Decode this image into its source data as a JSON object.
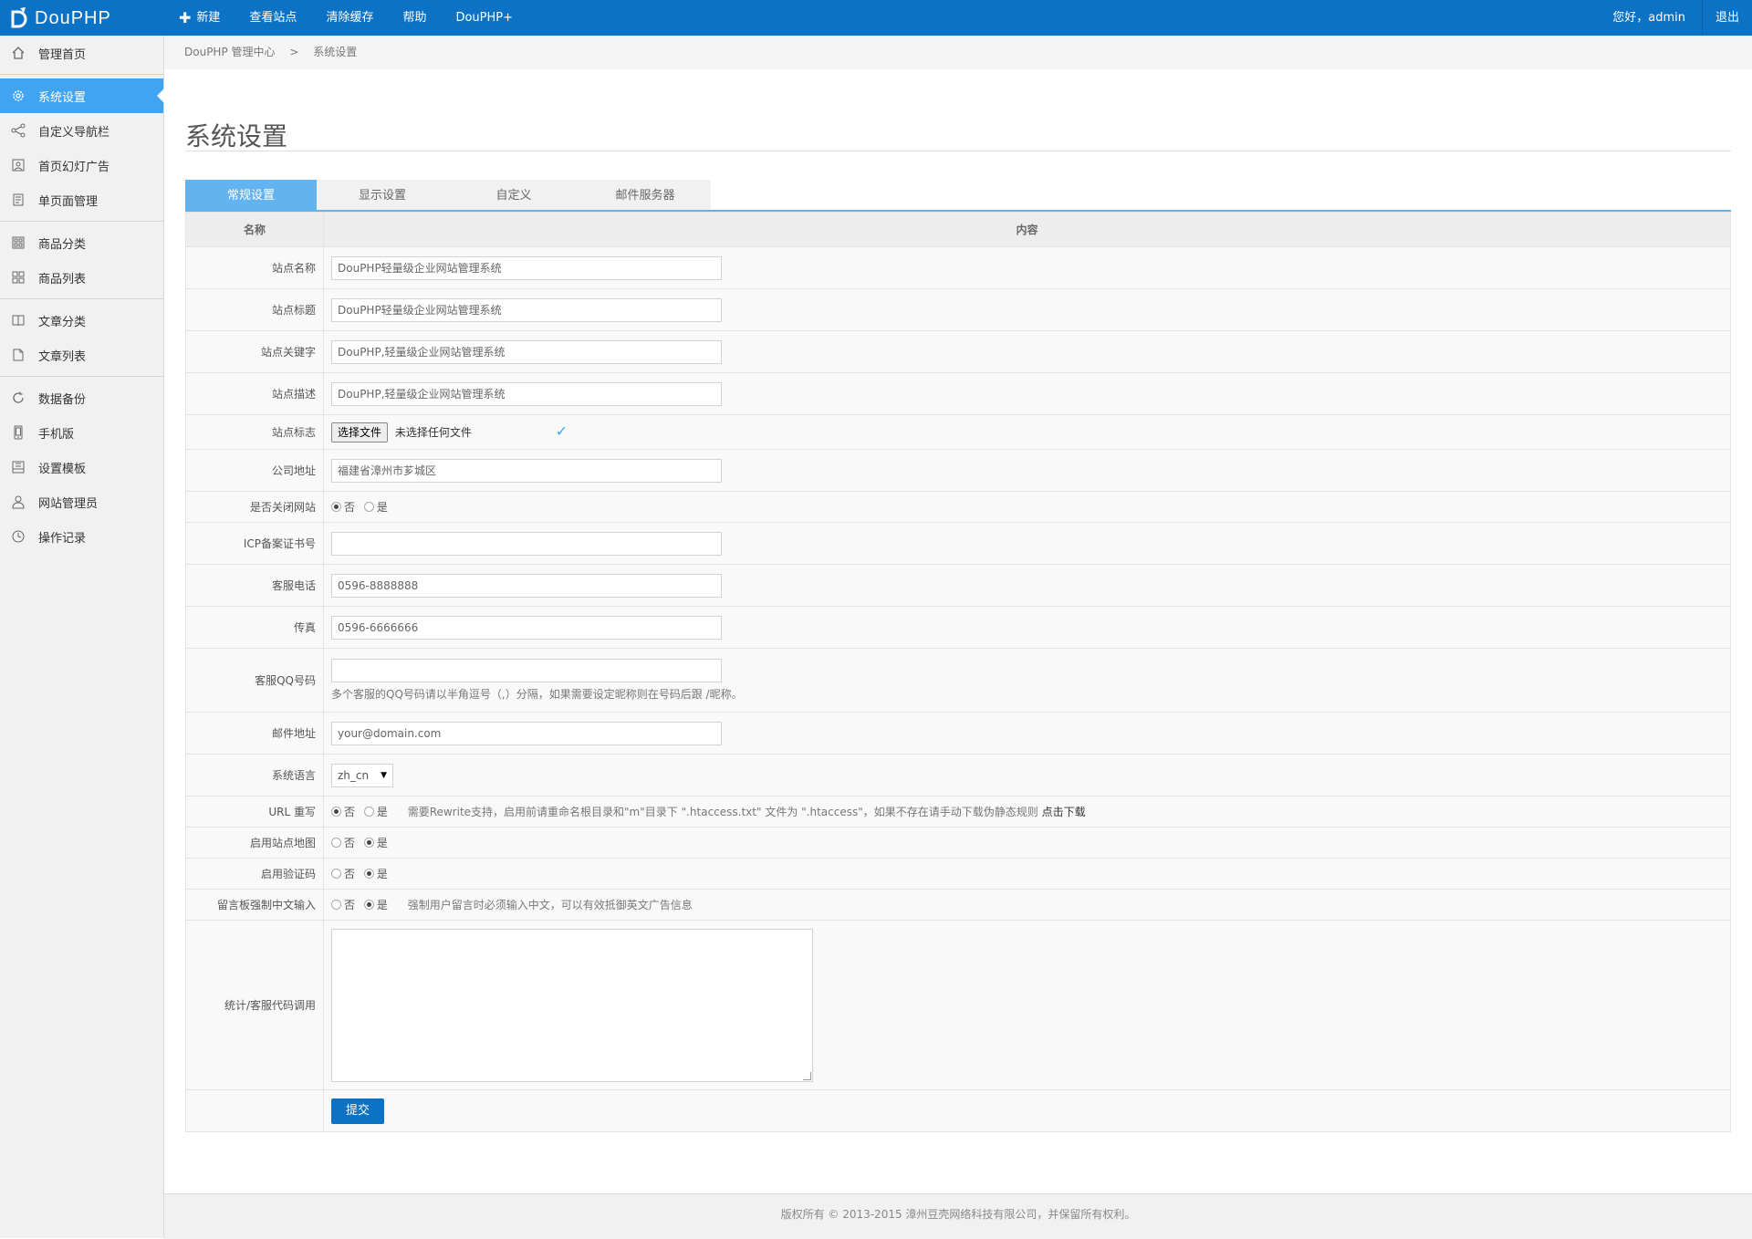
{
  "header": {
    "logo_text": "DouPHP",
    "nav": [
      "新建",
      "查看站点",
      "清除缓存",
      "帮助",
      "DouPHP+"
    ],
    "greeting": "您好，admin",
    "logout": "退出"
  },
  "sidebar": {
    "items": [
      {
        "label": "管理首页",
        "icon": "home-icon"
      },
      {
        "label": "系统设置",
        "icon": "gear-icon",
        "active": true
      },
      {
        "label": "自定义导航栏",
        "icon": "share-icon"
      },
      {
        "label": "首页幻灯广告",
        "icon": "image-icon"
      },
      {
        "label": "单页面管理",
        "icon": "document-icon"
      },
      {
        "label": "商品分类",
        "icon": "grid-icon"
      },
      {
        "label": "商品列表",
        "icon": "list-grid-icon"
      },
      {
        "label": "文章分类",
        "icon": "book-icon"
      },
      {
        "label": "文章列表",
        "icon": "file-icon"
      },
      {
        "label": "数据备份",
        "icon": "refresh-icon"
      },
      {
        "label": "手机版",
        "icon": "mobile-icon"
      },
      {
        "label": "设置模板",
        "icon": "template-icon"
      },
      {
        "label": "网站管理员",
        "icon": "user-icon"
      },
      {
        "label": "操作记录",
        "icon": "clock-icon"
      }
    ]
  },
  "breadcrumb": {
    "home": "DouPHP 管理中心",
    "sep": ">",
    "current": "系统设置"
  },
  "page_title": "系统设置",
  "tabs": [
    "常规设置",
    "显示设置",
    "自定义",
    "邮件服务器"
  ],
  "table": {
    "col_name": "名称",
    "col_content": "内容",
    "site_name": {
      "label": "站点名称",
      "value": "DouPHP轻量级企业网站管理系统"
    },
    "site_title": {
      "label": "站点标题",
      "value": "DouPHP轻量级企业网站管理系统"
    },
    "site_keywords": {
      "label": "站点关键字",
      "value": "DouPHP,轻量级企业网站管理系统"
    },
    "site_desc": {
      "label": "站点描述",
      "value": "DouPHP,轻量级企业网站管理系统"
    },
    "site_logo": {
      "label": "站点标志",
      "button": "选择文件",
      "status": "未选择任何文件"
    },
    "address": {
      "label": "公司地址",
      "value": "福建省漳州市芗城区"
    },
    "close_site": {
      "label": "是否关闭网站",
      "no": "否",
      "yes": "是"
    },
    "icp": {
      "label": "ICP备案证书号",
      "value": ""
    },
    "tel": {
      "label": "客服电话",
      "value": "0596-8888888"
    },
    "fax": {
      "label": "传真",
      "value": "0596-6666666"
    },
    "qq": {
      "label": "客服QQ号码",
      "value": "",
      "hint": "多个客服的QQ号码请以半角逗号（,）分隔，如果需要设定昵称则在号码后跟 /昵称。"
    },
    "email": {
      "label": "邮件地址",
      "value": "your@domain.com"
    },
    "language": {
      "label": "系统语言",
      "value": "zh_cn"
    },
    "rewrite": {
      "label": "URL 重写",
      "no": "否",
      "yes": "是",
      "note": "需要Rewrite支持，启用前请重命名根目录和\"m\"目录下 \".htaccess.txt\" 文件为 \".htaccess\"，如果不存在请手动下载伪静态规则",
      "link": "点击下载"
    },
    "sitemap": {
      "label": "启用站点地图",
      "no": "否",
      "yes": "是"
    },
    "captcha": {
      "label": "启用验证码",
      "no": "否",
      "yes": "是"
    },
    "guestbook": {
      "label": "留言板强制中文输入",
      "no": "否",
      "yes": "是",
      "note": "强制用户留言时必须输入中文，可以有效抵御英文广告信息"
    },
    "stats": {
      "label": "统计/客服代码调用"
    },
    "submit": "提交"
  },
  "footer": "版权所有 © 2013-2015 漳州豆壳网络科技有限公司，并保留所有权利。"
}
